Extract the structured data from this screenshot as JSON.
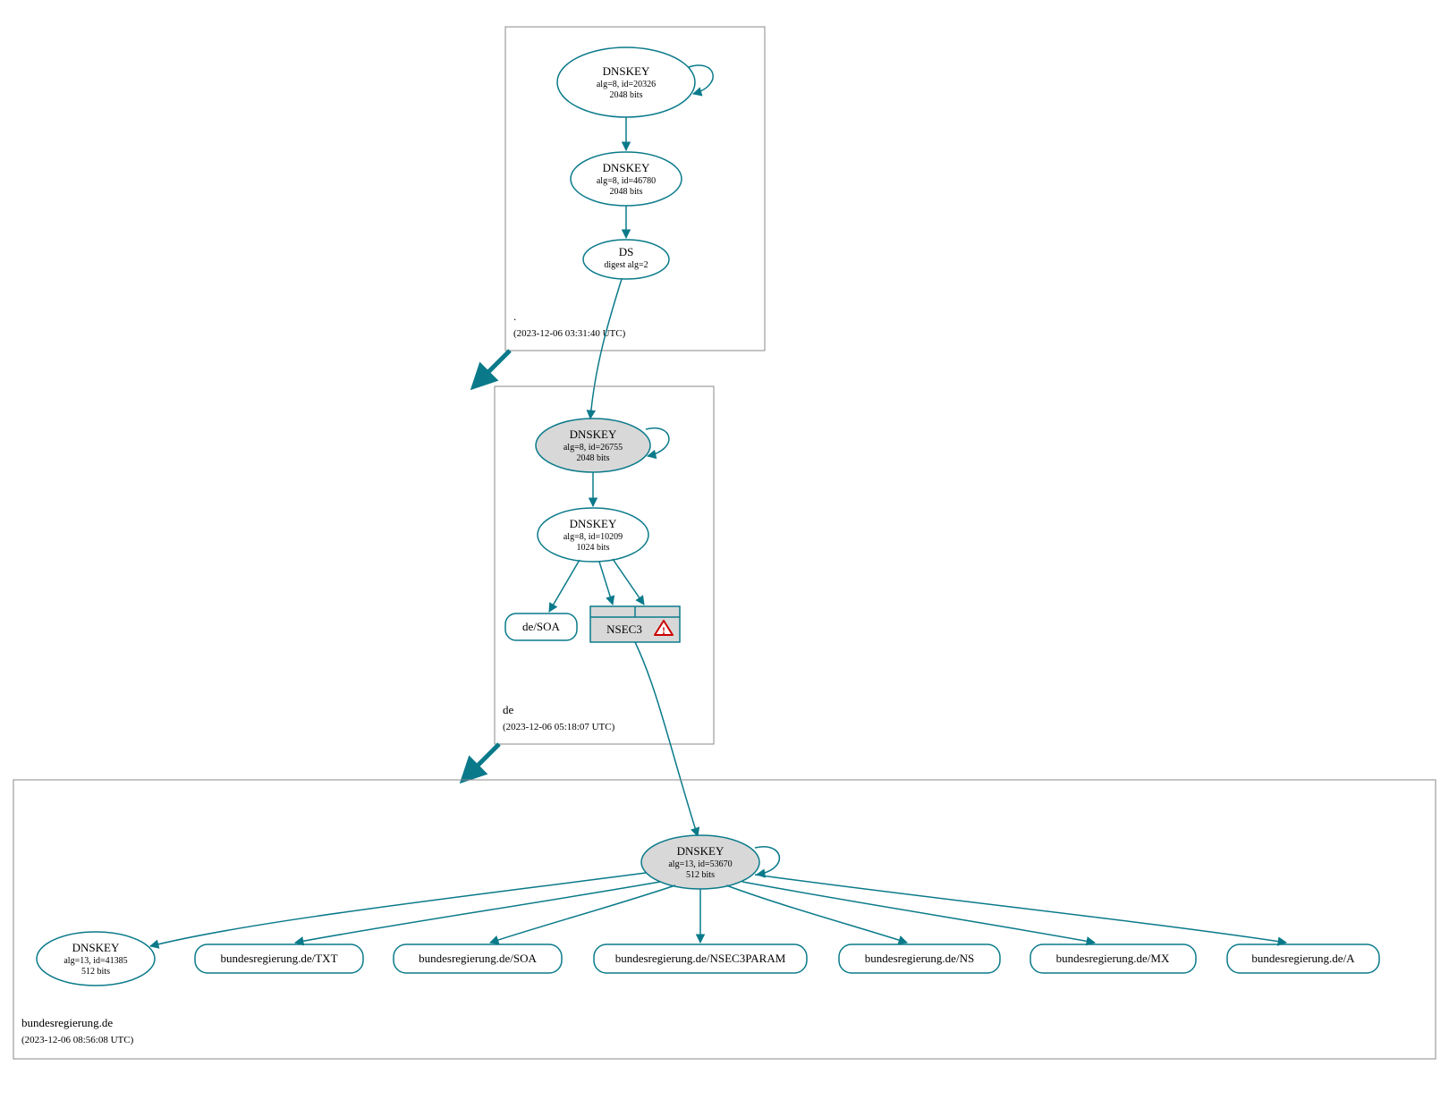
{
  "zones": {
    "root": {
      "label": ".",
      "time": "(2023-12-06 03:31:40 UTC)"
    },
    "de": {
      "label": "de",
      "time": "(2023-12-06 05:18:07 UTC)"
    },
    "leaf": {
      "label": "bundesregierung.de",
      "time": "(2023-12-06 08:56:08 UTC)"
    }
  },
  "nodes": {
    "root_ksk": {
      "title": "DNSKEY",
      "l1": "alg=8, id=20326",
      "l2": "2048 bits"
    },
    "root_zsk": {
      "title": "DNSKEY",
      "l1": "alg=8, id=46780",
      "l2": "2048 bits"
    },
    "root_ds": {
      "title": "DS",
      "l1": "digest alg=2"
    },
    "de_ksk": {
      "title": "DNSKEY",
      "l1": "alg=8, id=26755",
      "l2": "2048 bits"
    },
    "de_zsk": {
      "title": "DNSKEY",
      "l1": "alg=8, id=10209",
      "l2": "1024 bits"
    },
    "de_soa": {
      "label": "de/SOA"
    },
    "de_nsec3": {
      "label": "NSEC3"
    },
    "leaf_ksk": {
      "title": "DNSKEY",
      "l1": "alg=13, id=53670",
      "l2": "512 bits"
    },
    "leaf_zsk": {
      "title": "DNSKEY",
      "l1": "alg=13, id=41385",
      "l2": "512 bits"
    },
    "leaf_txt": {
      "label": "bundesregierung.de/TXT"
    },
    "leaf_soa": {
      "label": "bundesregierung.de/SOA"
    },
    "leaf_n3p": {
      "label": "bundesregierung.de/NSEC3PARAM"
    },
    "leaf_ns": {
      "label": "bundesregierung.de/NS"
    },
    "leaf_mx": {
      "label": "bundesregierung.de/MX"
    },
    "leaf_a": {
      "label": "bundesregierung.de/A"
    }
  }
}
